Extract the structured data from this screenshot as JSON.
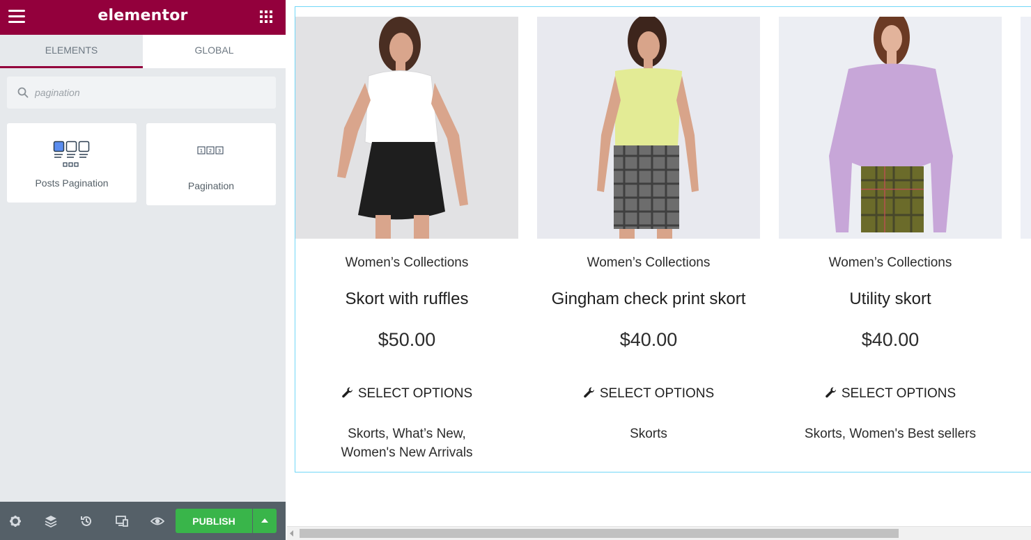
{
  "app": {
    "logo": "elementor"
  },
  "tabs": [
    {
      "label": "ELEMENTS",
      "active": true
    },
    {
      "label": "GLOBAL",
      "active": false
    }
  ],
  "search": {
    "value": "",
    "placeholder": "pagination"
  },
  "widgets": [
    {
      "label": "Posts Pagination",
      "icon": "posts-pagination-icon"
    },
    {
      "label": "Pagination",
      "icon": "pagination-icon"
    }
  ],
  "footer": {
    "publish_label": "PUBLISH",
    "icons": [
      "settings-icon",
      "navigator-icon",
      "history-icon",
      "responsive-icon",
      "preview-icon"
    ]
  },
  "colors": {
    "brand": "#93003c",
    "publish": "#39b54a",
    "panel": "#e6e9ec",
    "footer": "#556068",
    "section_outline": "#71d7f7"
  },
  "products": [
    {
      "category": "Women’s Collections",
      "title": "Skort with ruffles",
      "price": "$50.00",
      "button": "SELECT OPTIONS",
      "tags": "Skorts, What’s New, Women's New Arrivals"
    },
    {
      "category": "Women’s Collections",
      "title": "Gingham check print skort",
      "price": "$40.00",
      "button": "SELECT OPTIONS",
      "tags": "Skorts"
    },
    {
      "category": "Women’s Collections",
      "title": "Utility skort",
      "price": "$40.00",
      "button": "SELECT OPTIONS",
      "tags": "Skorts, Women's Best sellers"
    }
  ]
}
